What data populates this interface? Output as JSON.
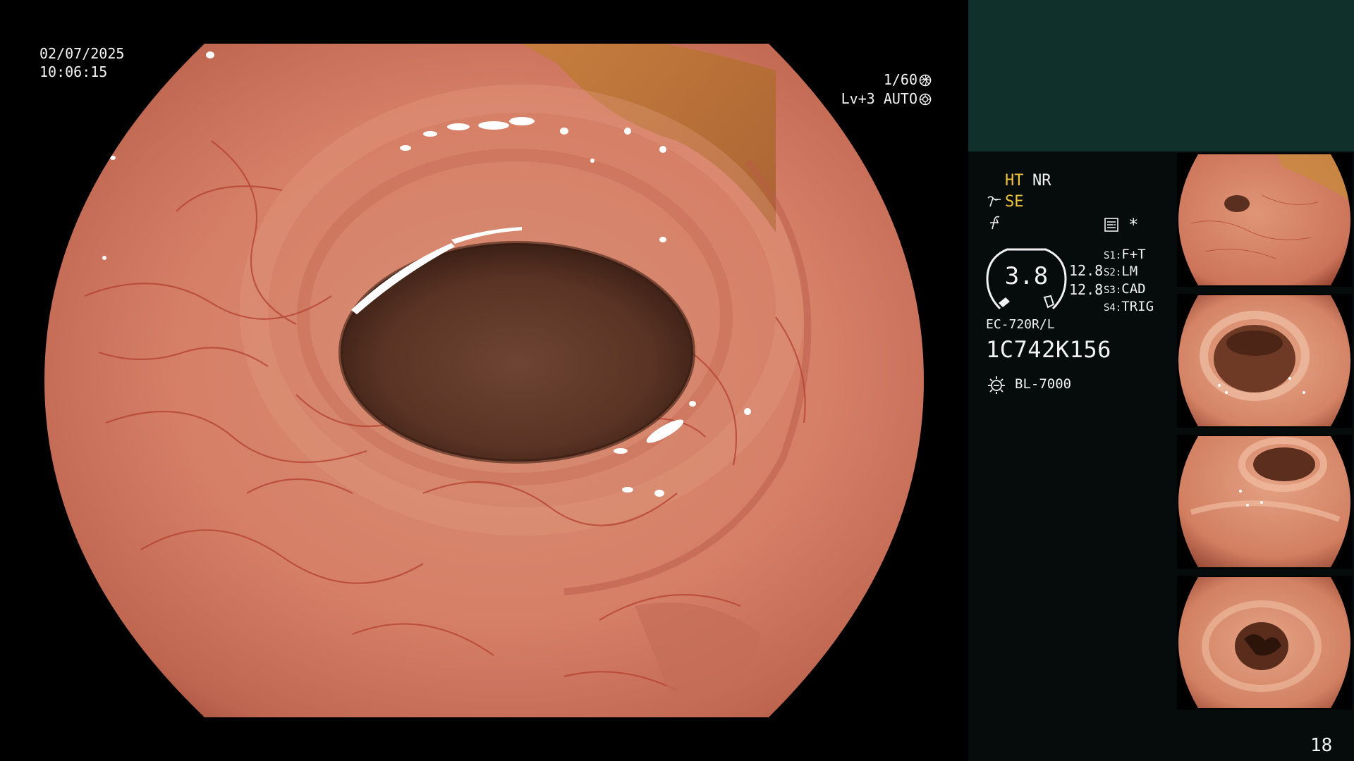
{
  "main_view": {
    "date": "02/07/2025",
    "time": "10:06:15",
    "shutter": "1/60",
    "mode": "Lv+3 AUTO",
    "shutter_icon": "aperture-icon",
    "mode_icon": "auto-iris-icon"
  },
  "side_panel": {
    "ht_label": "HT",
    "nr_label": "NR",
    "se_label": "SE",
    "se_icon": "se-enhance-icon",
    "f_icon": "f-script-icon",
    "memo_icon": "memo-icon",
    "star_label": "*",
    "dial_value": "3.8",
    "gain_values": [
      "12.8",
      "12.8"
    ],
    "switches": [
      {
        "key": "S1:",
        "value": "F+T"
      },
      {
        "key": "S2:",
        "value": "LM"
      },
      {
        "key": "S3:",
        "value": "CAD"
      },
      {
        "key": "S4:",
        "value": "TRIG"
      }
    ],
    "scope_model": "EC-720R/L",
    "scope_serial": "1C742K156",
    "light_icon": "light-source-icon",
    "light_source": "BL-7000",
    "page_number": "18"
  },
  "colors": {
    "label_yellow": "#f0c33c",
    "panel_top": "#10302c",
    "panel_bg": "#050c0b",
    "mucosa": "#d9816c"
  }
}
